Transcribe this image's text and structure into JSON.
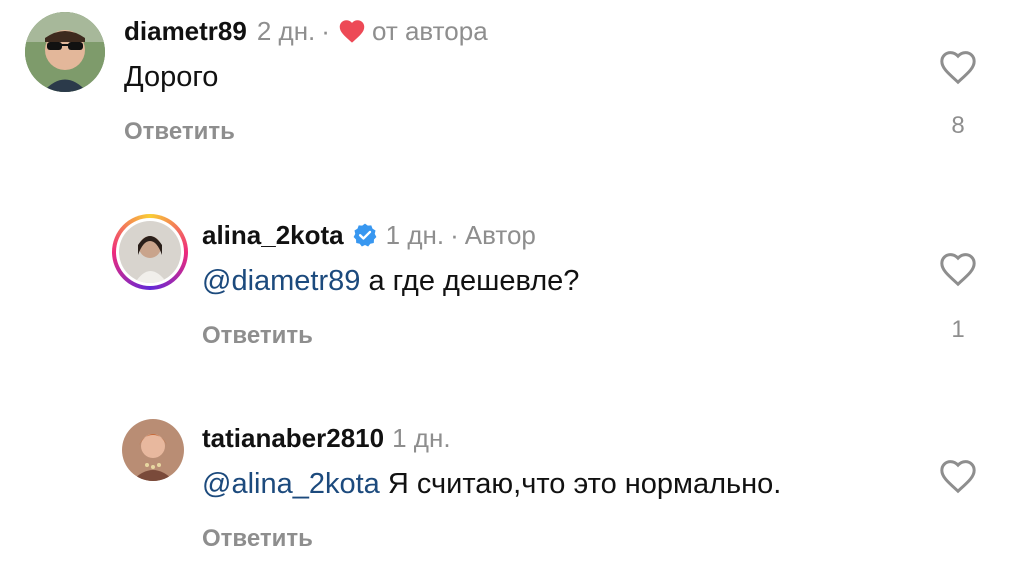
{
  "comments": [
    {
      "username": "diametr89",
      "time": "2 дн.",
      "author_like": "от автора",
      "mention": "",
      "text": "Дорого",
      "reply_label": "Ответить",
      "likes": "8"
    },
    {
      "username": "alina_2kota",
      "time": "1 дн.",
      "author_badge": "Автор",
      "mention": "@diametr89",
      "text": "а где дешевле?",
      "reply_label": "Ответить",
      "likes": "1"
    },
    {
      "username": "tatianaber2810",
      "time": "1 дн.",
      "mention": "@alina_2kota",
      "text": "Я считаю,что это нормально.",
      "reply_label": "Ответить"
    }
  ],
  "colors": {
    "mention": "#1c4a7d",
    "muted": "#8e8e8e",
    "heart_red": "#ed4956",
    "verified_blue": "#3897f0"
  },
  "icons": {
    "like": "heart-outline-icon",
    "author_like": "heart-filled-icon",
    "verified": "verified-badge-icon"
  }
}
